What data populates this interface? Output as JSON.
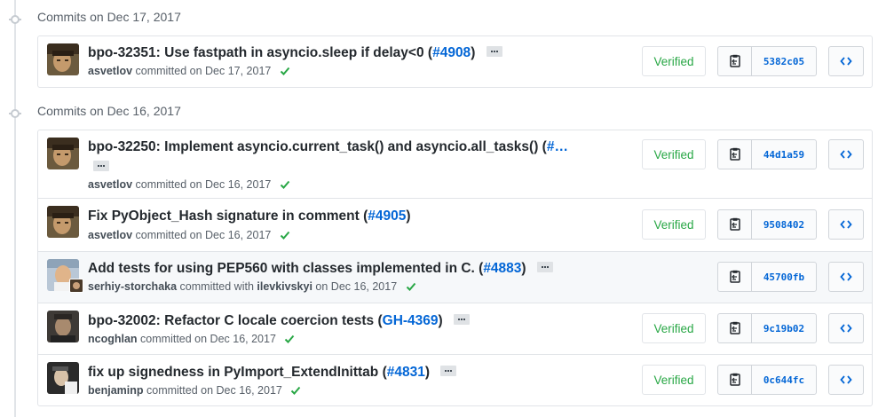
{
  "groups": [
    {
      "title": "Commits on Dec 17, 2017",
      "commits": [
        {
          "message": "bpo-32351: Use fastpath in asyncio.sleep if delay<0 (",
          "pr": "#4908",
          "pr_suffix": ")",
          "author": "asvetlov",
          "meta": " committed on Dec 17, 2017",
          "verified": "Verified",
          "sha": "5382c05"
        }
      ]
    },
    {
      "title": "Commits on Dec 16, 2017",
      "commits": [
        {
          "message": "bpo-32250: Implement asyncio.current_task() and asyncio.all_tasks() (",
          "pr": "#…",
          "author": "asvetlov",
          "meta": " committed on Dec 16, 2017",
          "verified": "Verified",
          "sha": "44d1a59"
        },
        {
          "message": "Fix PyObject_Hash signature in comment (",
          "pr": "#4905",
          "pr_suffix": ")",
          "author": "asvetlov",
          "meta": " committed on Dec 16, 2017",
          "verified": "Verified",
          "sha": "9508402"
        },
        {
          "message": "Add tests for using PEP560 with classes implemented in C. (",
          "pr": "#4883",
          "pr_suffix": ")",
          "author": "serhiy-storchaka",
          "meta_mid": " committed with ",
          "coauthor": "ilevkivskyi",
          "meta": " on Dec 16, 2017",
          "sha": "45700fb"
        },
        {
          "message": "bpo-32002: Refactor C locale coercion tests (",
          "pr": "GH-4369",
          "pr_suffix": ")",
          "author": "ncoghlan",
          "meta": " committed on Dec 16, 2017",
          "verified": "Verified",
          "sha": "9c19b02"
        },
        {
          "message": "fix up signedness in PyImport_ExtendInittab (",
          "pr": "#4831",
          "pr_suffix": ")",
          "author": "benjaminp",
          "meta": " committed on Dec 16, 2017",
          "verified": "Verified",
          "sha": "0c644fc"
        }
      ]
    }
  ],
  "icons": {
    "commit": "git-commit-icon",
    "check": "check-icon",
    "copy": "clipboard-icon",
    "browse": "code-icon"
  },
  "colors": {
    "link": "#0366d6",
    "verified": "#28a745",
    "muted": "#586069",
    "border": "#e1e4e8"
  }
}
